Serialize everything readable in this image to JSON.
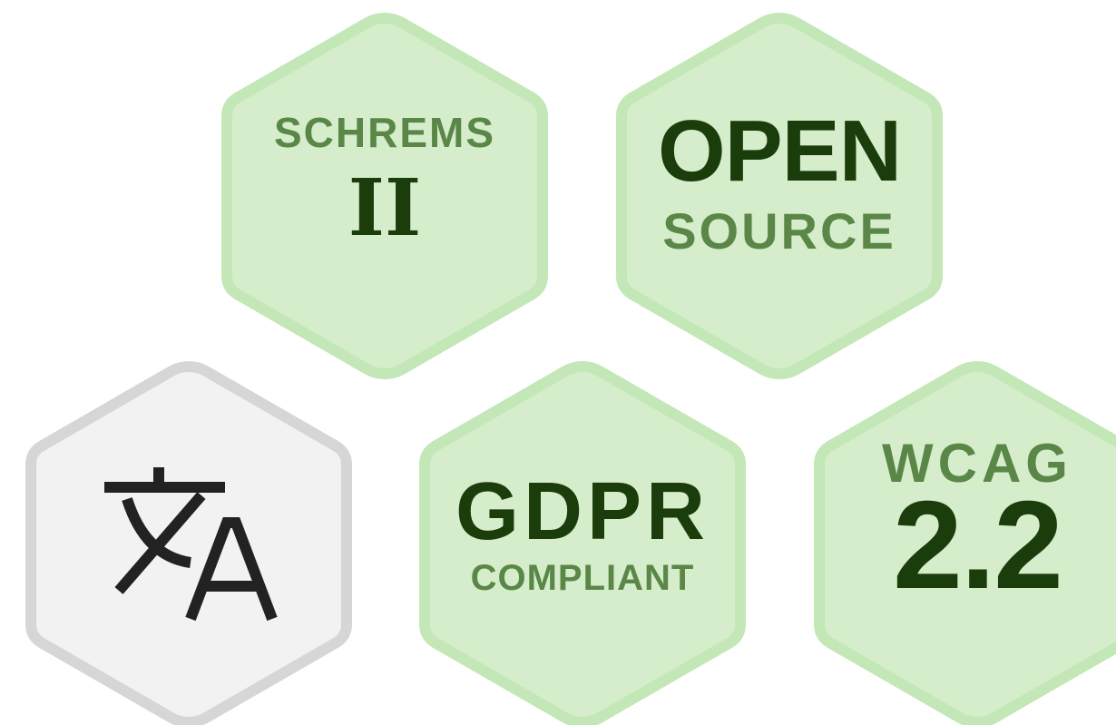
{
  "colors": {
    "green_fill": "#d5edcb",
    "green_stroke": "#c3e7b6",
    "grey_fill": "#f2f2f2",
    "grey_stroke": "#d6d6d6",
    "text_dark": "#1b3d0c",
    "text_mid": "#5a8748",
    "icon_dark": "#222222"
  },
  "badges": [
    {
      "id": "schrems",
      "line1": "SCHREMS",
      "line2": "II",
      "theme": "green"
    },
    {
      "id": "open-source",
      "line1": "OPEN",
      "line2": "SOURCE",
      "theme": "green"
    },
    {
      "id": "translate",
      "icon": "translate-icon",
      "theme": "grey"
    },
    {
      "id": "gdpr",
      "line1": "GDPR",
      "line2": "COMPLIANT",
      "theme": "green"
    },
    {
      "id": "wcag",
      "line1": "WCAG",
      "line2": "2.2",
      "theme": "green"
    }
  ]
}
